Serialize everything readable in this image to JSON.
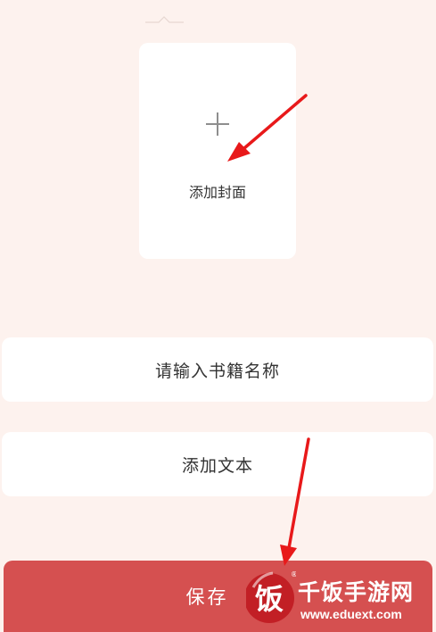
{
  "cover": {
    "icon": "plus-icon",
    "label": "添加封面"
  },
  "form": {
    "name_placeholder": "请输入书籍名称",
    "text_label": "添加文本"
  },
  "toolbar": {
    "save_label": "保存"
  },
  "watermark": {
    "site_name": "千饭手游网",
    "url": "www.eduext.com",
    "logo_char": "饭"
  },
  "colors": {
    "background": "#fdf2ee",
    "save_button": "#d55050",
    "annotation_arrow": "#e8191a",
    "text": "#333333",
    "plus_icon": "#8e8e8e"
  }
}
